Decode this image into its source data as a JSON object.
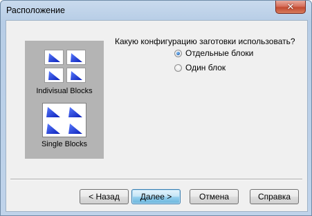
{
  "window": {
    "title": "Расположение",
    "close_symbol": "✕"
  },
  "preview": {
    "individual_caption": "Indivisual Blocks",
    "single_caption": "Single Blocks",
    "triangle_color": "#1f3fe0",
    "panel_color": "#b4b4b4"
  },
  "config": {
    "question": "Какую конфигурацию заготовки использовать?",
    "options": [
      {
        "label": "Отдельные блоки",
        "selected": true
      },
      {
        "label": "Один блок",
        "selected": false
      }
    ]
  },
  "buttons": {
    "back": "< Назад",
    "next": "Далее >",
    "cancel": "Отмена",
    "help": "Справка"
  }
}
